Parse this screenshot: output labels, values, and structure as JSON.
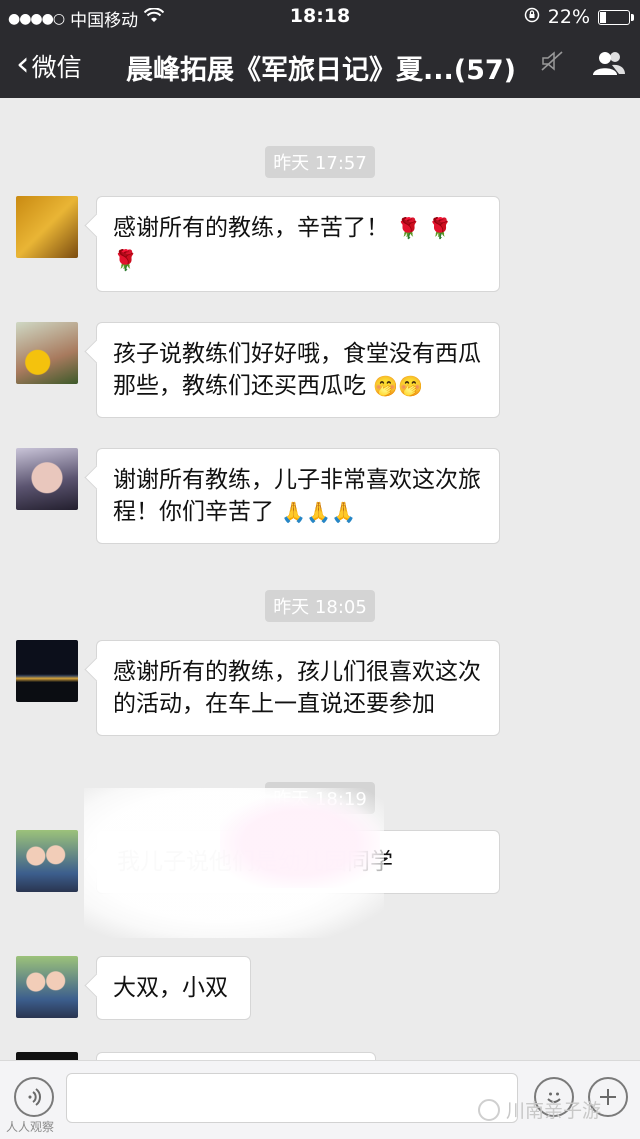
{
  "status_bar": {
    "signal": "●●●●○",
    "carrier": "中国移动",
    "wifi_icon": "wifi-icon",
    "time": "18:18",
    "battery_percent": "22%",
    "battery_level": 0.22
  },
  "nav": {
    "back_label": "微信",
    "title": "晨峰拓展《军旅日记》夏...(57)"
  },
  "messages": [
    {
      "type": "timestamp",
      "text": "昨天 17:57"
    },
    {
      "type": "message",
      "text": "感谢所有的教练，辛苦了！",
      "emoji": "🌹 🌹 🌹"
    },
    {
      "type": "message",
      "text": "孩子说教练们好好哦，食堂没有西瓜那些，教练们还买西瓜吃",
      "emoji": "🤭🤭"
    },
    {
      "type": "message",
      "text": "谢谢所有教练，儿子非常喜欢这次旅程！你们辛苦了",
      "emoji": "🙏🙏🙏"
    },
    {
      "type": "timestamp",
      "text": "昨天 18:05"
    },
    {
      "type": "message",
      "text": "感谢所有的教练，孩儿们很喜欢这次的活动，在车上一直说还要参加",
      "emoji": ""
    },
    {
      "type": "timestamp",
      "text": "昨天 18:19"
    },
    {
      "type": "message",
      "text": "我儿子说他们是幼儿园同学",
      "emoji": ""
    },
    {
      "type": "message",
      "text": "大双，小双",
      "emoji": ""
    }
  ],
  "watermark": {
    "left": "人人观察",
    "right": "川南亲子游"
  }
}
